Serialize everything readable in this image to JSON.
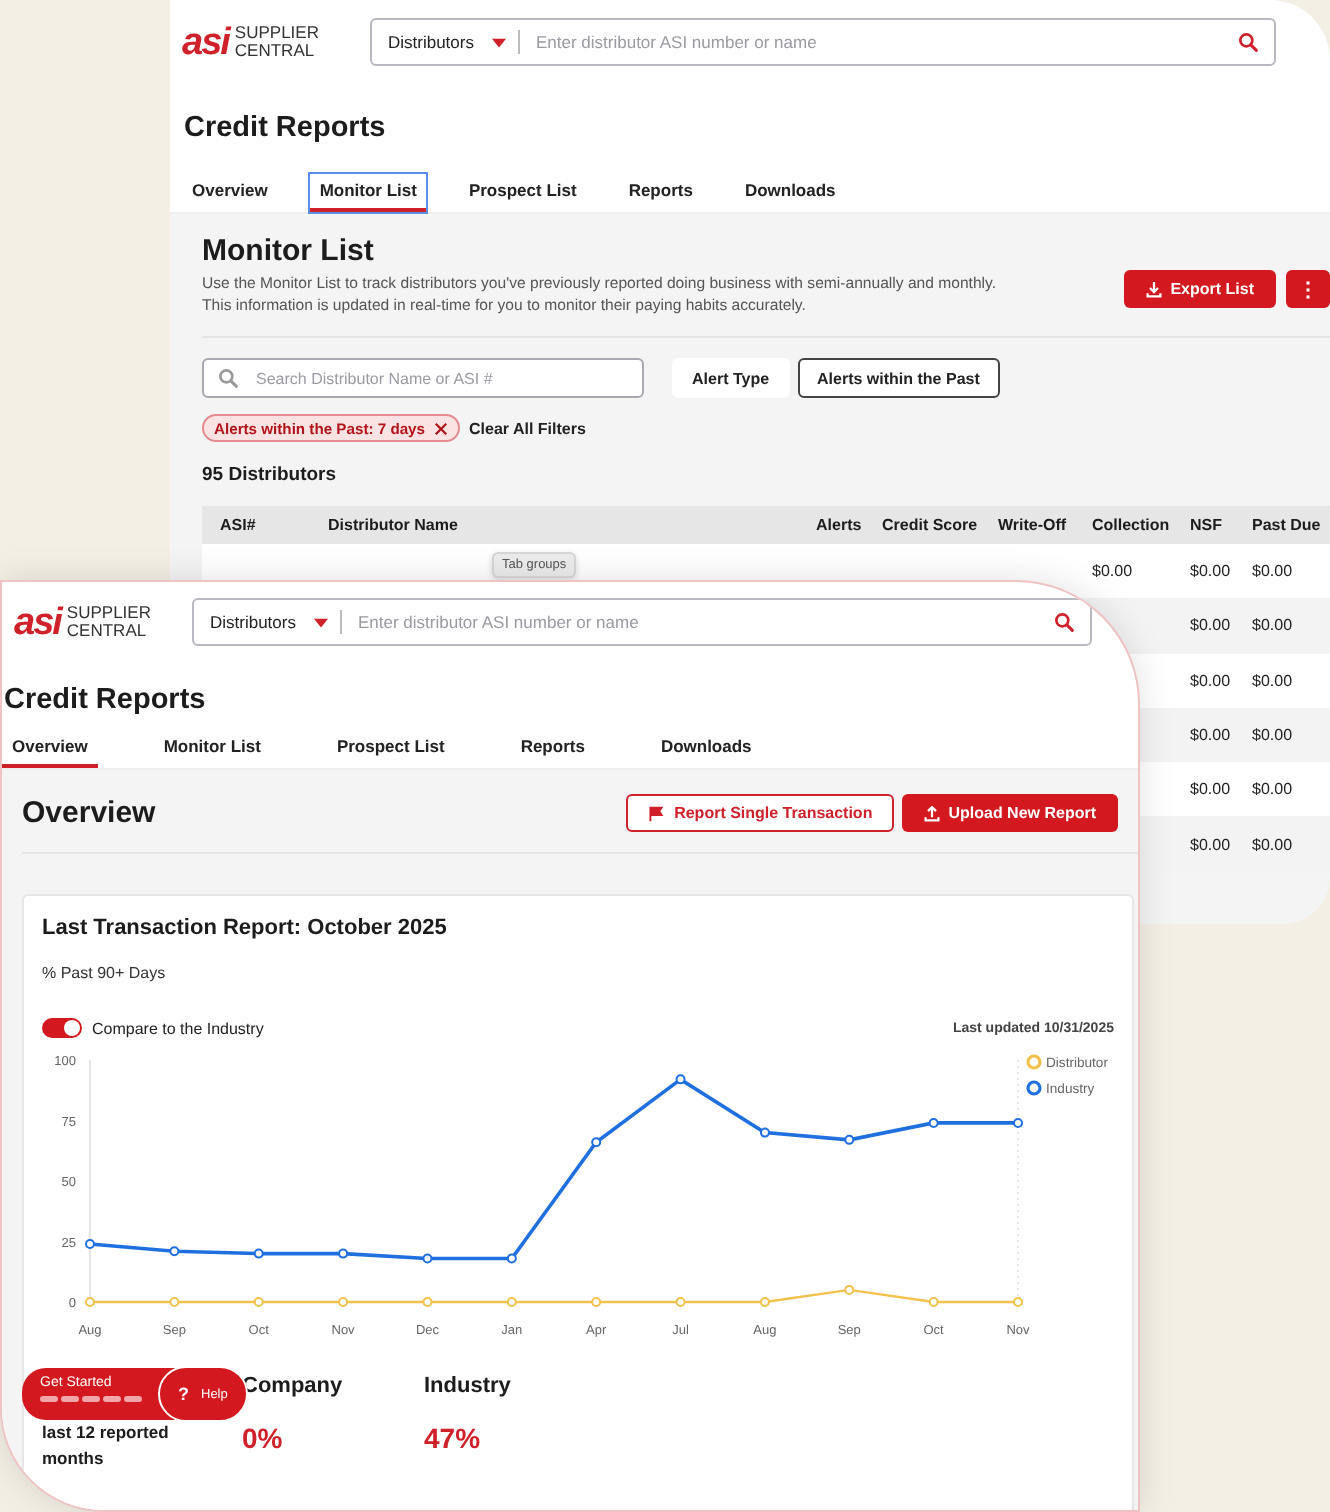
{
  "back_window": {
    "header": {
      "logo_mark": "asi",
      "brand_name": "SUPPLIER CENTRAL",
      "search": {
        "category": "Distributors",
        "placeholder": "Enter distributor ASI number or name"
      }
    },
    "title": "Credit Reports",
    "tabs": [
      {
        "label": "Overview",
        "selected": false,
        "focused": false
      },
      {
        "label": "Monitor List",
        "selected": true,
        "focused": true
      },
      {
        "label": "Prospect List",
        "selected": false,
        "focused": false
      },
      {
        "label": "Reports",
        "selected": false,
        "focused": false
      },
      {
        "label": "Downloads",
        "selected": false,
        "focused": false
      }
    ],
    "monitor_list": {
      "heading": "Monitor List",
      "description": "Use the Monitor List to track distributors you've previously reported doing business with semi-annually and monthly. This information is updated in real-time for you to monitor their paying habits accurately.",
      "export_button": "Export List",
      "more_button": "⋮",
      "search": {
        "placeholder": "Search Distributor Name or ASI #"
      },
      "filters": [
        {
          "label": "Alert Type",
          "selected": false
        },
        {
          "label": "Alerts within the Past",
          "selected": true
        }
      ],
      "active_filter": "Alerts within the Past: 7 days",
      "clear_filters": "Clear All Filters",
      "count": "95 Distributors",
      "table": {
        "columns": [
          "ASI#",
          "Distributor Name",
          "Alerts",
          "Credit Score",
          "Write-Off",
          "Collection",
          "NSF",
          "Past Due"
        ],
        "rows": [
          {
            "cells": [
              "",
              "",
              "",
              "",
              "",
              "$0.00",
              "$0.00",
              "$0.00"
            ]
          },
          {
            "cells": [
              "",
              "",
              "",
              "",
              "",
              "",
              "$0.00",
              "$0.00"
            ]
          },
          {
            "cells": [
              "",
              "",
              "",
              "",
              "",
              "",
              "$0.00",
              "$0.00"
            ]
          },
          {
            "cells": [
              "",
              "",
              "",
              "",
              "",
              "",
              "$0.00",
              "$0.00"
            ]
          },
          {
            "cells": [
              "",
              "",
              "",
              "",
              "",
              "",
              "$0.00",
              "$0.00"
            ]
          },
          {
            "cells": [
              "",
              "",
              "",
              "",
              "",
              "",
              "$0.00",
              "$0.00"
            ]
          }
        ]
      },
      "tooltip": "Tab groups"
    }
  },
  "front_window": {
    "header": {
      "logo_mark": "asi",
      "brand_name": "SUPPLIER CENTRAL",
      "search": {
        "category": "Distributors",
        "placeholder": "Enter distributor ASI number or name"
      }
    },
    "title": "Credit Reports",
    "tabs": [
      {
        "label": "Overview",
        "selected": true,
        "focused": false
      },
      {
        "label": "Monitor List",
        "selected": false,
        "focused": false
      },
      {
        "label": "Prospect List",
        "selected": false,
        "focused": false
      },
      {
        "label": "Reports",
        "selected": false,
        "focused": false
      },
      {
        "label": "Downloads",
        "selected": false,
        "focused": false
      }
    ],
    "overview": {
      "heading": "Overview",
      "report_button": "Report Single Transaction",
      "upload_button": "Upload New Report",
      "card": {
        "title": "Last Transaction Report: October 2025",
        "subtitle": "% Past 90+ Days",
        "compare_toggle": {
          "label": "Compare to the Industry",
          "on": true
        },
        "last_updated": "Last updated 10/31/2025",
        "chart_data": {
          "type": "line",
          "categories": [
            "Aug",
            "Sep",
            "Oct",
            "Nov",
            "Dec",
            "Jan",
            "Apr",
            "Jul",
            "Aug",
            "Sep",
            "Oct",
            "Nov"
          ],
          "ylim": [
            0,
            100
          ],
          "yticks": [
            0,
            25,
            50,
            75,
            100
          ],
          "legend": true,
          "series": [
            {
              "name": "Distributor",
              "color": "#f2c14e",
              "marker": "circle",
              "values": [
                0,
                0,
                0,
                0,
                0,
                0,
                0,
                0,
                0,
                5,
                0,
                0
              ]
            },
            {
              "name": "Industry",
              "color": "#1f6fe0",
              "marker": "circle",
              "values": [
                24,
                21,
                20,
                20,
                18,
                18,
                66,
                92,
                70,
                67,
                74,
                74
              ]
            }
          ]
        },
        "stats": {
          "label": "last 12 reported months",
          "columns": [
            {
              "heading": "Company",
              "value": "0%"
            },
            {
              "heading": "Industry",
              "value": "47%"
            }
          ]
        }
      }
    },
    "floating_buttons": [
      {
        "kind": "start",
        "label": "Get Started"
      },
      {
        "kind": "help",
        "icon": "?",
        "label": "Help"
      }
    ]
  }
}
